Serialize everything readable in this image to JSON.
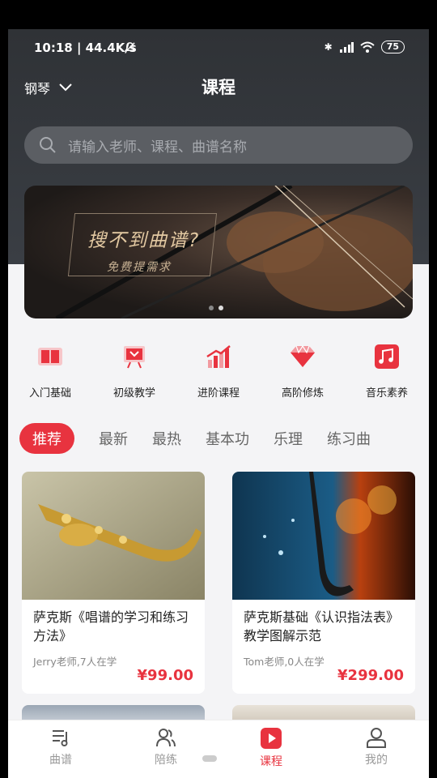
{
  "status": {
    "time_speed": "10:18 | 44.4K/s",
    "battery": "75"
  },
  "header": {
    "instrument": "钢琴",
    "title": "课程"
  },
  "search": {
    "placeholder": "请输入老师、课程、曲谱名称"
  },
  "banner": {
    "title": "搜不到曲谱?",
    "subtitle": "免费提需求",
    "pages": 2,
    "active_page": 1
  },
  "categories": [
    {
      "label": "入门基础",
      "icon": "book-icon"
    },
    {
      "label": "初级教学",
      "icon": "presentation-board-icon"
    },
    {
      "label": "进阶课程",
      "icon": "bar-chart-growth-icon"
    },
    {
      "label": "高阶修炼",
      "icon": "diamond-icon"
    },
    {
      "label": "音乐素养",
      "icon": "music-note-icon"
    }
  ],
  "tabs": [
    "推荐",
    "最新",
    "最热",
    "基本功",
    "乐理",
    "练习曲"
  ],
  "courses": [
    {
      "title": "萨克斯《唱谱的学习和练习方法》",
      "meta": "Jerry老师,7人在学",
      "price": "¥99.00"
    },
    {
      "title": "萨克斯基础《认识指法表》教学图解示范",
      "meta": "Tom老师,0人在学",
      "price": "¥299.00"
    }
  ],
  "nav": [
    {
      "label": "曲谱",
      "icon": "score-icon"
    },
    {
      "label": "陪练",
      "icon": "people-icon"
    },
    {
      "label": "课程",
      "icon": "play-icon"
    },
    {
      "label": "我的",
      "icon": "user-icon"
    }
  ],
  "colors": {
    "accent": "#e8333f",
    "header": "#2f3236"
  }
}
